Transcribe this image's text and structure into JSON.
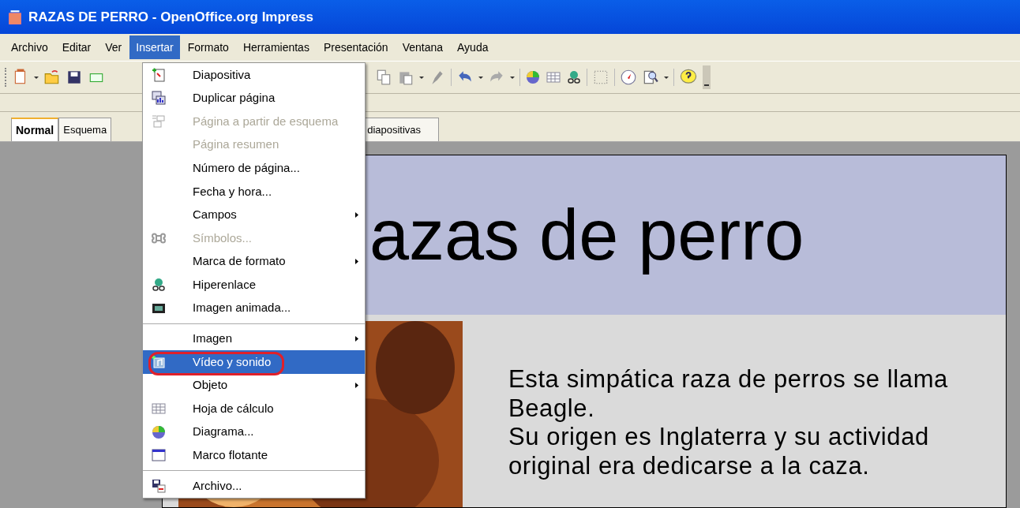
{
  "window": {
    "title": "RAZAS DE PERRO - OpenOffice.org Impress"
  },
  "menu_bar": [
    {
      "label": "Archivo",
      "selected": false
    },
    {
      "label": "Editar",
      "selected": false
    },
    {
      "label": "Ver",
      "selected": false
    },
    {
      "label": "Insertar",
      "selected": true
    },
    {
      "label": "Formato",
      "selected": false
    },
    {
      "label": "Herramientas",
      "selected": false
    },
    {
      "label": "Presentación",
      "selected": false
    },
    {
      "label": "Ventana",
      "selected": false
    },
    {
      "label": "Ayuda",
      "selected": false
    }
  ],
  "insert_menu": [
    {
      "kind": "item",
      "label": "Diapositiva",
      "disabled": false,
      "submenu": false,
      "selected": false
    },
    {
      "kind": "item",
      "label": "Duplicar página",
      "disabled": false,
      "submenu": false,
      "selected": false
    },
    {
      "kind": "item",
      "label": "Página a partir de esquema",
      "disabled": true,
      "submenu": false,
      "selected": false
    },
    {
      "kind": "item",
      "label": "Página resumen",
      "disabled": true,
      "submenu": false,
      "selected": false
    },
    {
      "kind": "item",
      "label": "Número de página...",
      "disabled": false,
      "submenu": false,
      "selected": false
    },
    {
      "kind": "item",
      "label": "Fecha y hora...",
      "disabled": false,
      "submenu": false,
      "selected": false
    },
    {
      "kind": "item",
      "label": "Campos",
      "disabled": false,
      "submenu": true,
      "selected": false
    },
    {
      "kind": "item",
      "label": "Símbolos...",
      "disabled": true,
      "submenu": false,
      "selected": false
    },
    {
      "kind": "item",
      "label": "Marca de formato",
      "disabled": false,
      "submenu": true,
      "selected": false
    },
    {
      "kind": "item",
      "label": "Hiperenlace",
      "disabled": false,
      "submenu": false,
      "selected": false
    },
    {
      "kind": "item",
      "label": "Imagen animada...",
      "disabled": false,
      "submenu": false,
      "selected": false
    },
    {
      "kind": "separator"
    },
    {
      "kind": "item",
      "label": "Imagen",
      "disabled": false,
      "submenu": true,
      "selected": false
    },
    {
      "kind": "item",
      "label": "Vídeo y sonido",
      "disabled": false,
      "submenu": false,
      "selected": true
    },
    {
      "kind": "item",
      "label": "Objeto",
      "disabled": false,
      "submenu": true,
      "selected": false
    },
    {
      "kind": "item",
      "label": "Hoja de cálculo",
      "disabled": false,
      "submenu": false,
      "selected": false
    },
    {
      "kind": "item",
      "label": "Diagrama...",
      "disabled": false,
      "submenu": false,
      "selected": false
    },
    {
      "kind": "item",
      "label": "Marco flotante",
      "disabled": false,
      "submenu": false,
      "selected": false
    },
    {
      "kind": "separator"
    },
    {
      "kind": "item",
      "label": "Archivo...",
      "disabled": false,
      "submenu": false,
      "selected": false
    }
  ],
  "view_tabs": [
    {
      "label": "Normal",
      "selected": true
    },
    {
      "label": "Esquema",
      "selected": false
    },
    {
      "label": "diapositivas",
      "selected": false
    }
  ],
  "slide": {
    "title": "azas de perro",
    "body": [
      "Esta simpática raza de perros se llama Beagle.",
      "Su origen es Inglaterra y su actividad original era dedicarse a la caza."
    ]
  }
}
